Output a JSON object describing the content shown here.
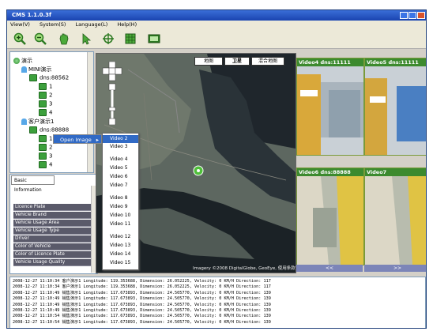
{
  "window": {
    "title": "CMS 1.1.0.3f"
  },
  "menu": [
    "View(V)",
    "System(S)",
    "Language(L)",
    "Help(H)"
  ],
  "toolbar": [
    "zoom-in-icon",
    "zoom-out-icon",
    "hand-pan-icon",
    "select-arrow-icon",
    "crosshair-icon",
    "grid-icon",
    "monitor-icon"
  ],
  "tree": {
    "root": "演示",
    "group1": "MINI演示",
    "device1": "dns:88562",
    "ch1": [
      "1",
      "2",
      "3",
      "4"
    ],
    "group2": "客户演示1",
    "device2": "dns:88888",
    "ch2": [
      "1",
      "2",
      "3",
      "4"
    ]
  },
  "context_menu": {
    "item": "Open Image",
    "arrow": "▸"
  },
  "submenu": [
    "Video 2",
    "Video 3",
    "Video 4",
    "Video 5",
    "Video 6",
    "Video 7",
    "Video 8",
    "Video 9",
    "Video 10",
    "Video 11",
    "Video 12",
    "Video 13",
    "Video 14",
    "Video 15"
  ],
  "info": {
    "tab": "Basic Information",
    "rows": [
      "Licence Plate",
      "Vehicle Brand",
      "Vehicle Usage Area",
      "Vehicle Usage Type",
      "Driver",
      "Color of Vehicle",
      "Color of Licence Plate",
      "Vehicle Usage Quality"
    ]
  },
  "map": {
    "buttons": [
      "地图",
      "卫星",
      "混合地图"
    ],
    "copyright": "Imagery ©2008 DigitalGlobe, GeoEye, 使用条款"
  },
  "videos": [
    {
      "title": "Video4  dns:11111"
    },
    {
      "title": "Video5  dns:11111"
    },
    {
      "title": "Video6  dns:88888"
    },
    {
      "title": "Video7"
    }
  ],
  "video_nav": {
    "prev": "<<",
    "next": ">>"
  },
  "log": [
    "2008-12-27 11:10:34 客户演示1 Longitude: 119.353688, Dimension: 26.052225, Velocity: 0 KM/H Direction: 117",
    "2008-12-27 11:10:34 客户演示1 Longitude: 119.353688, Dimension: 26.052225, Velocity: 0 KM/H Direction: 117",
    "2008-12-27 11:10:49 销售演示1 Longitude: 117.673893, Dimension: 24.505770, Velocity: 0 KM/H Direction: 139",
    "2008-12-27 11:10:49 销售演示1 Longitude: 117.673893, Dimension: 24.505770, Velocity: 0 KM/H Direction: 139",
    "2008-12-27 11:10:49 销售演示1 Longitude: 117.673893, Dimension: 24.505770, Velocity: 0 KM/H Direction: 139",
    "2008-12-27 11:10:49 销售演示1 Longitude: 117.673893, Dimension: 24.505770, Velocity: 0 KM/H Direction: 139",
    "2008-12-27 11:10:54 销售演示1 Longitude: 117.673893, Dimension: 24.505770, Velocity: 0 KM/H Direction: 139",
    "2008-12-27 11:10:54 销售演示1 Longitude: 117.673893, Dimension: 24.505770, Velocity: 0 KM/H Direction: 139"
  ],
  "colors": {
    "video_header": "#3c8a2e",
    "nav_bar": "#7c85b8",
    "selection": "#316ac5",
    "title_bar": "#1a44b0"
  }
}
